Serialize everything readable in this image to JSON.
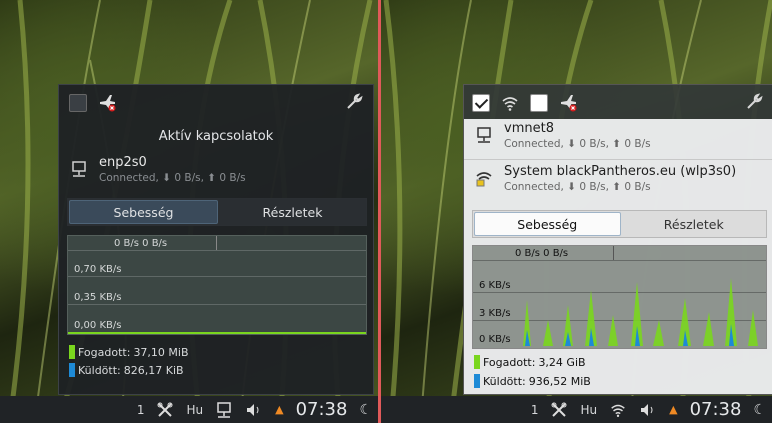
{
  "left": {
    "title": "Aktív kapcsolatok",
    "connections": [
      {
        "name": "enp2s0",
        "status": "Connected, ⬇ 0 B/s, ⬆ 0 B/s"
      }
    ],
    "tabs": [
      "Sebesség",
      "Részletek"
    ],
    "graph": {
      "header": "0 B/s 0 B/s",
      "y_labels": [
        "0,70 KB/s",
        "0,35 KB/s",
        "0,00 KB/s"
      ]
    },
    "legend": [
      {
        "label": "Fogadott:",
        "value": "37,10 MiB",
        "color": "#7ad61e"
      },
      {
        "label": "Küldött:",
        "value": "826,17 KiB",
        "color": "#1e8ad6"
      }
    ],
    "taskbar": {
      "desktop": "1",
      "lang": "Hu",
      "clock": "07:38"
    }
  },
  "right": {
    "connections": [
      {
        "name": "vmnet8",
        "status": "Connected, ⬇ 0 B/s, ⬆ 0 B/s"
      },
      {
        "name": "System blackPantheros.eu (wlp3s0)",
        "status": "Connected, ⬇ 0 B/s, ⬆ 0 B/s"
      }
    ],
    "tabs": [
      "Sebesség",
      "Részletek"
    ],
    "graph": {
      "header": "0 B/s 0 B/s",
      "y_labels": [
        "6 KB/s",
        "3 KB/s",
        "0 KB/s"
      ]
    },
    "legend": [
      {
        "label": "Fogadott:",
        "value": "3,24 GiB",
        "color": "#7ad61e"
      },
      {
        "label": "Küldött:",
        "value": "936,52 MiB",
        "color": "#1e8ad6"
      }
    ],
    "taskbar": {
      "desktop": "1",
      "lang": "Hu",
      "clock": "07:38"
    }
  },
  "icons": {
    "checkbox": "checkbox-icon",
    "airplane": "airplane-mode-icon",
    "wrench": "settings-wrench-icon",
    "wired": "wired-network-icon",
    "wifi": "wifi-icon",
    "volume": "volume-icon",
    "bluetooth_like": "kde-connect-icon"
  }
}
